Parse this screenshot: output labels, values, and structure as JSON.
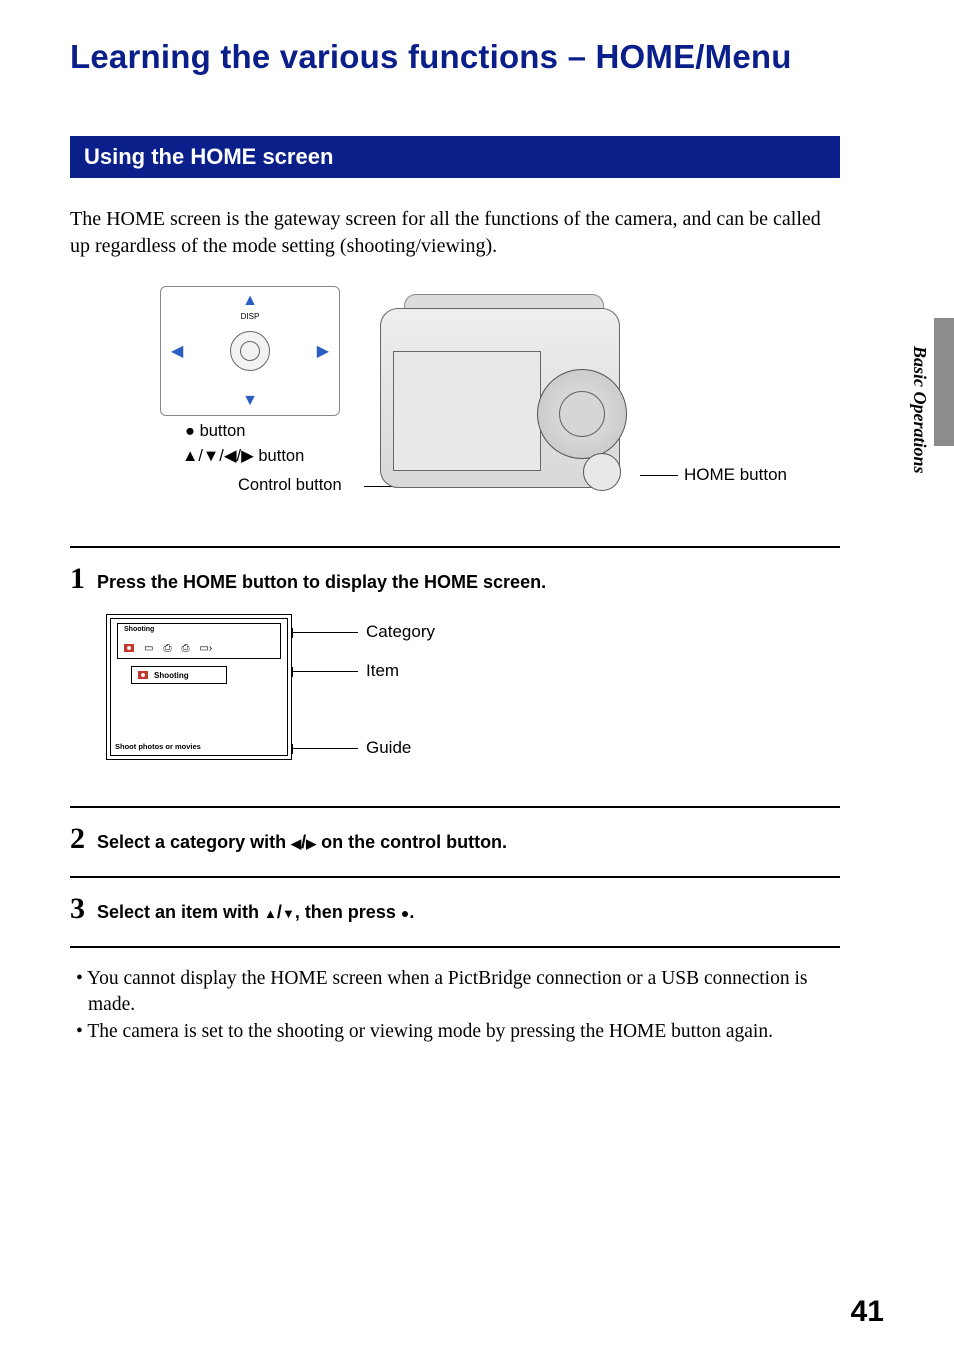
{
  "page_title": "Learning the various functions – HOME/Menu",
  "section_title": "Using the HOME screen",
  "intro": "The HOME screen is the gateway screen for all the functions of the camera, and can be called up regardless of the mode setting (shooting/viewing).",
  "figure": {
    "disp": "DISP",
    "dot_button": "button",
    "arrow_button": "▲/▼/◀/▶ button",
    "control_button": "Control button",
    "home_button": "HOME button"
  },
  "steps": {
    "s1": {
      "num": "1",
      "text": "Press the HOME button to display the HOME screen."
    },
    "s2": {
      "num": "2",
      "text_before": "Select a category with ",
      "text_after": " on the control button."
    },
    "s3": {
      "num": "3",
      "text_before": "Select an item with ",
      "text_mid": ", then press ",
      "text_after": "."
    }
  },
  "home_mock": {
    "cat_title": "Shooting",
    "item_text": "Shooting",
    "guide_text": "Shoot photos or movies",
    "callouts": {
      "category": "Category",
      "item": "Item",
      "guide": "Guide"
    }
  },
  "notes": [
    "You cannot display the HOME screen when a PictBridge connection or a USB connection is made.",
    "The camera is set to the shooting or viewing mode by pressing the HOME button again."
  ],
  "side_label": "Basic Operations",
  "page_number": "41"
}
